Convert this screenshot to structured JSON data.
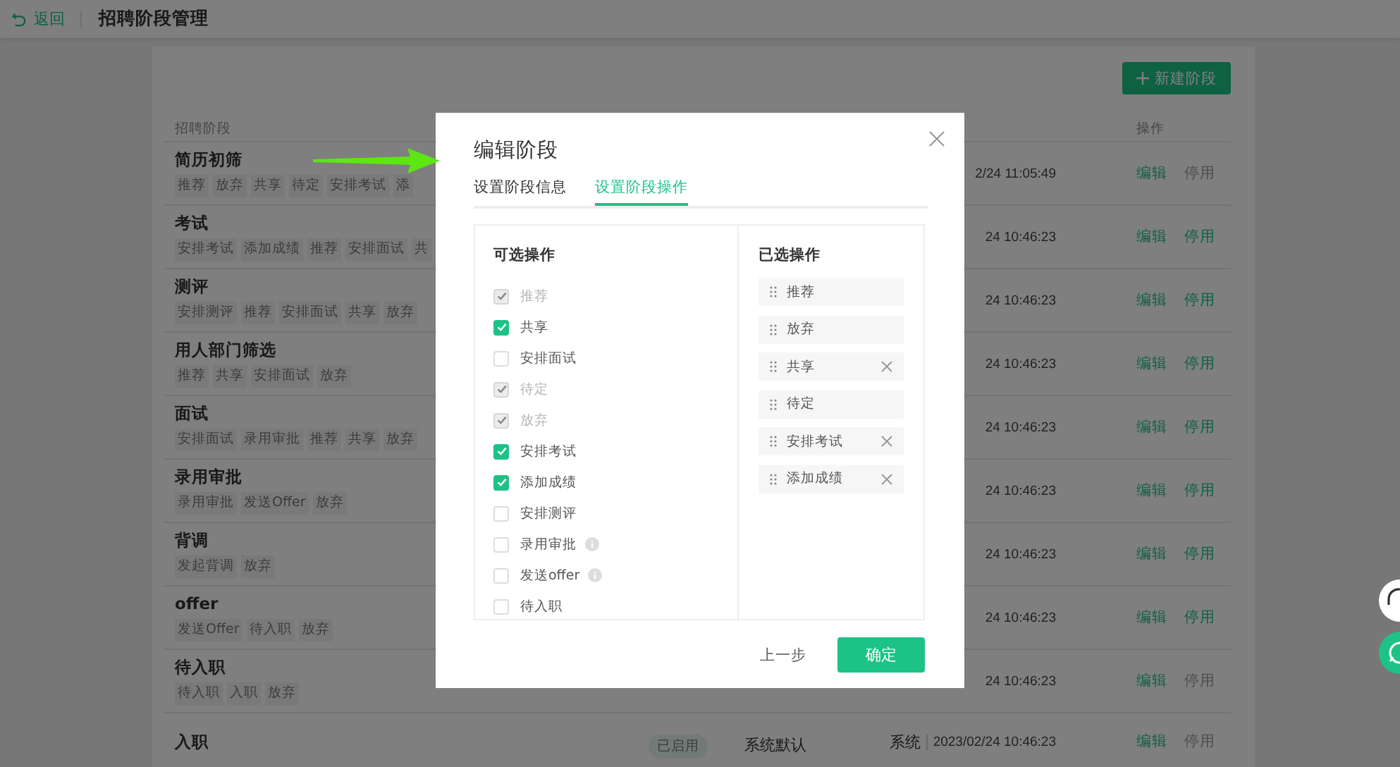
{
  "header": {
    "back": "返回",
    "title": "招聘阶段管理"
  },
  "new_stage_button": "新建阶段",
  "table": {
    "columns": [
      "招聘阶段",
      "操作"
    ],
    "rows": [
      {
        "name": "简历初筛",
        "tags": [
          "推荐",
          "放弃",
          "共享",
          "待定",
          "安排考试",
          "添"
        ],
        "time": "2/24 11:05:49",
        "actions": [
          {
            "label": "编辑",
            "disabled": false
          },
          {
            "label": "停用",
            "disabled": true
          }
        ]
      },
      {
        "name": "考试",
        "tags": [
          "安排考试",
          "添加成绩",
          "推荐",
          "安排面试",
          "共"
        ],
        "time": "24 10:46:23",
        "actions": [
          {
            "label": "编辑",
            "disabled": false
          },
          {
            "label": "停用",
            "disabled": false
          }
        ]
      },
      {
        "name": "测评",
        "tags": [
          "安排测评",
          "推荐",
          "安排面试",
          "共享",
          "放弃"
        ],
        "time": "24 10:46:23",
        "actions": [
          {
            "label": "编辑",
            "disabled": false
          },
          {
            "label": "停用",
            "disabled": false
          }
        ]
      },
      {
        "name": "用人部门筛选",
        "tags": [
          "推荐",
          "共享",
          "安排面试",
          "放弃"
        ],
        "time": "24 10:46:23",
        "actions": [
          {
            "label": "编辑",
            "disabled": false
          },
          {
            "label": "停用",
            "disabled": false
          }
        ]
      },
      {
        "name": "面试",
        "tags": [
          "安排面试",
          "录用审批",
          "推荐",
          "共享",
          "放弃"
        ],
        "time": "24 10:46:23",
        "actions": [
          {
            "label": "编辑",
            "disabled": false
          },
          {
            "label": "停用",
            "disabled": false
          }
        ]
      },
      {
        "name": "录用审批",
        "tags": [
          "录用审批",
          "发送Offer",
          "放弃"
        ],
        "time": "24 10:46:23",
        "actions": [
          {
            "label": "编辑",
            "disabled": false
          },
          {
            "label": "停用",
            "disabled": false
          }
        ]
      },
      {
        "name": "背调",
        "tags": [
          "发起背调",
          "放弃"
        ],
        "time": "24 10:46:23",
        "actions": [
          {
            "label": "编辑",
            "disabled": false
          },
          {
            "label": "停用",
            "disabled": false
          }
        ]
      },
      {
        "name": "offer",
        "tags": [
          "发送Offer",
          "待入职",
          "放弃"
        ],
        "time": "24 10:46:23",
        "actions": [
          {
            "label": "编辑",
            "disabled": false
          },
          {
            "label": "停用",
            "disabled": false
          }
        ]
      },
      {
        "name": "待入职",
        "tags": [
          "待入职",
          "入职",
          "放弃"
        ],
        "time": "24 10:46:23",
        "actions": [
          {
            "label": "编辑",
            "disabled": false
          },
          {
            "label": "停用",
            "disabled": true
          }
        ]
      },
      {
        "name": "入职",
        "status": "已启用",
        "source": "系统默认",
        "creator": "系统",
        "time": "2023/02/24 10:46:23",
        "actions": [
          {
            "label": "编辑",
            "disabled": false
          },
          {
            "label": "停用",
            "disabled": true
          }
        ]
      }
    ]
  },
  "dialog": {
    "title": "编辑阶段",
    "tabs": [
      {
        "label": "设置阶段信息",
        "selected": false
      },
      {
        "label": "设置阶段操作",
        "selected": true
      }
    ],
    "available": {
      "title": "可选操作",
      "items": [
        {
          "label": "推荐",
          "checked": true,
          "disabled": true,
          "info": false
        },
        {
          "label": "共享",
          "checked": true,
          "disabled": false,
          "info": false
        },
        {
          "label": "安排面试",
          "checked": false,
          "disabled": false,
          "info": false
        },
        {
          "label": "待定",
          "checked": true,
          "disabled": true,
          "info": false
        },
        {
          "label": "放弃",
          "checked": true,
          "disabled": true,
          "info": false
        },
        {
          "label": "安排考试",
          "checked": true,
          "disabled": false,
          "info": false
        },
        {
          "label": "添加成绩",
          "checked": true,
          "disabled": false,
          "info": false
        },
        {
          "label": "安排测评",
          "checked": false,
          "disabled": false,
          "info": false
        },
        {
          "label": "录用审批",
          "checked": false,
          "disabled": false,
          "info": true
        },
        {
          "label": "发送offer",
          "checked": false,
          "disabled": false,
          "info": true
        },
        {
          "label": "待入职",
          "checked": false,
          "disabled": false,
          "info": false
        }
      ]
    },
    "chosen": {
      "title": "已选操作",
      "items": [
        {
          "label": "推荐",
          "removable": false
        },
        {
          "label": "放弃",
          "removable": false
        },
        {
          "label": "共享",
          "removable": true
        },
        {
          "label": "待定",
          "removable": false
        },
        {
          "label": "安排考试",
          "removable": true
        },
        {
          "label": "添加成绩",
          "removable": true
        }
      ]
    },
    "buttons": [
      {
        "label": "上一步",
        "kind": "text"
      },
      {
        "label": "确定",
        "kind": "primary"
      }
    ]
  }
}
